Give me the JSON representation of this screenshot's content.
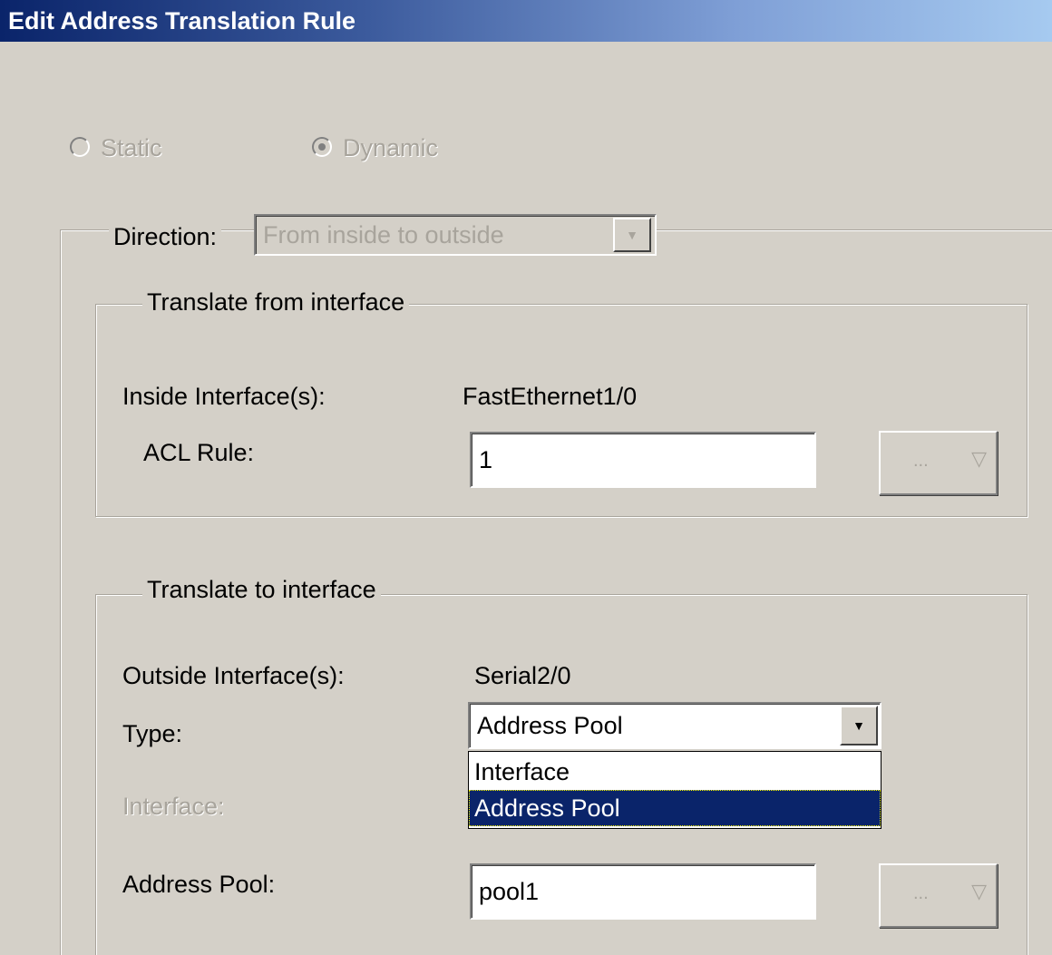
{
  "window": {
    "title": "Edit Address Translation Rule"
  },
  "mode": {
    "static_label": "Static",
    "dynamic_label": "Dynamic",
    "selected": "Dynamic"
  },
  "direction": {
    "label": "Direction:",
    "value": "From inside to outside"
  },
  "translate_from": {
    "legend": "Translate from interface",
    "inside_label": "Inside Interface(s):",
    "inside_value": "FastEthernet1/0",
    "acl_label": "ACL Rule:",
    "acl_value": "1",
    "acl_button": "..."
  },
  "translate_to": {
    "legend": "Translate to interface",
    "outside_label": "Outside Interface(s):",
    "outside_value": "Serial2/0",
    "type_label": "Type:",
    "type_value": "Address Pool",
    "type_options": [
      "Interface",
      "Address Pool"
    ],
    "type_highlighted": "Address Pool",
    "interface_label": "Interface:",
    "pool_label": "Address Pool:",
    "pool_value": "pool1",
    "pool_button": "..."
  },
  "icons": {
    "dropdown_arrow": "chevron-down-icon",
    "menu_arrow": "triangle-down-icon"
  }
}
